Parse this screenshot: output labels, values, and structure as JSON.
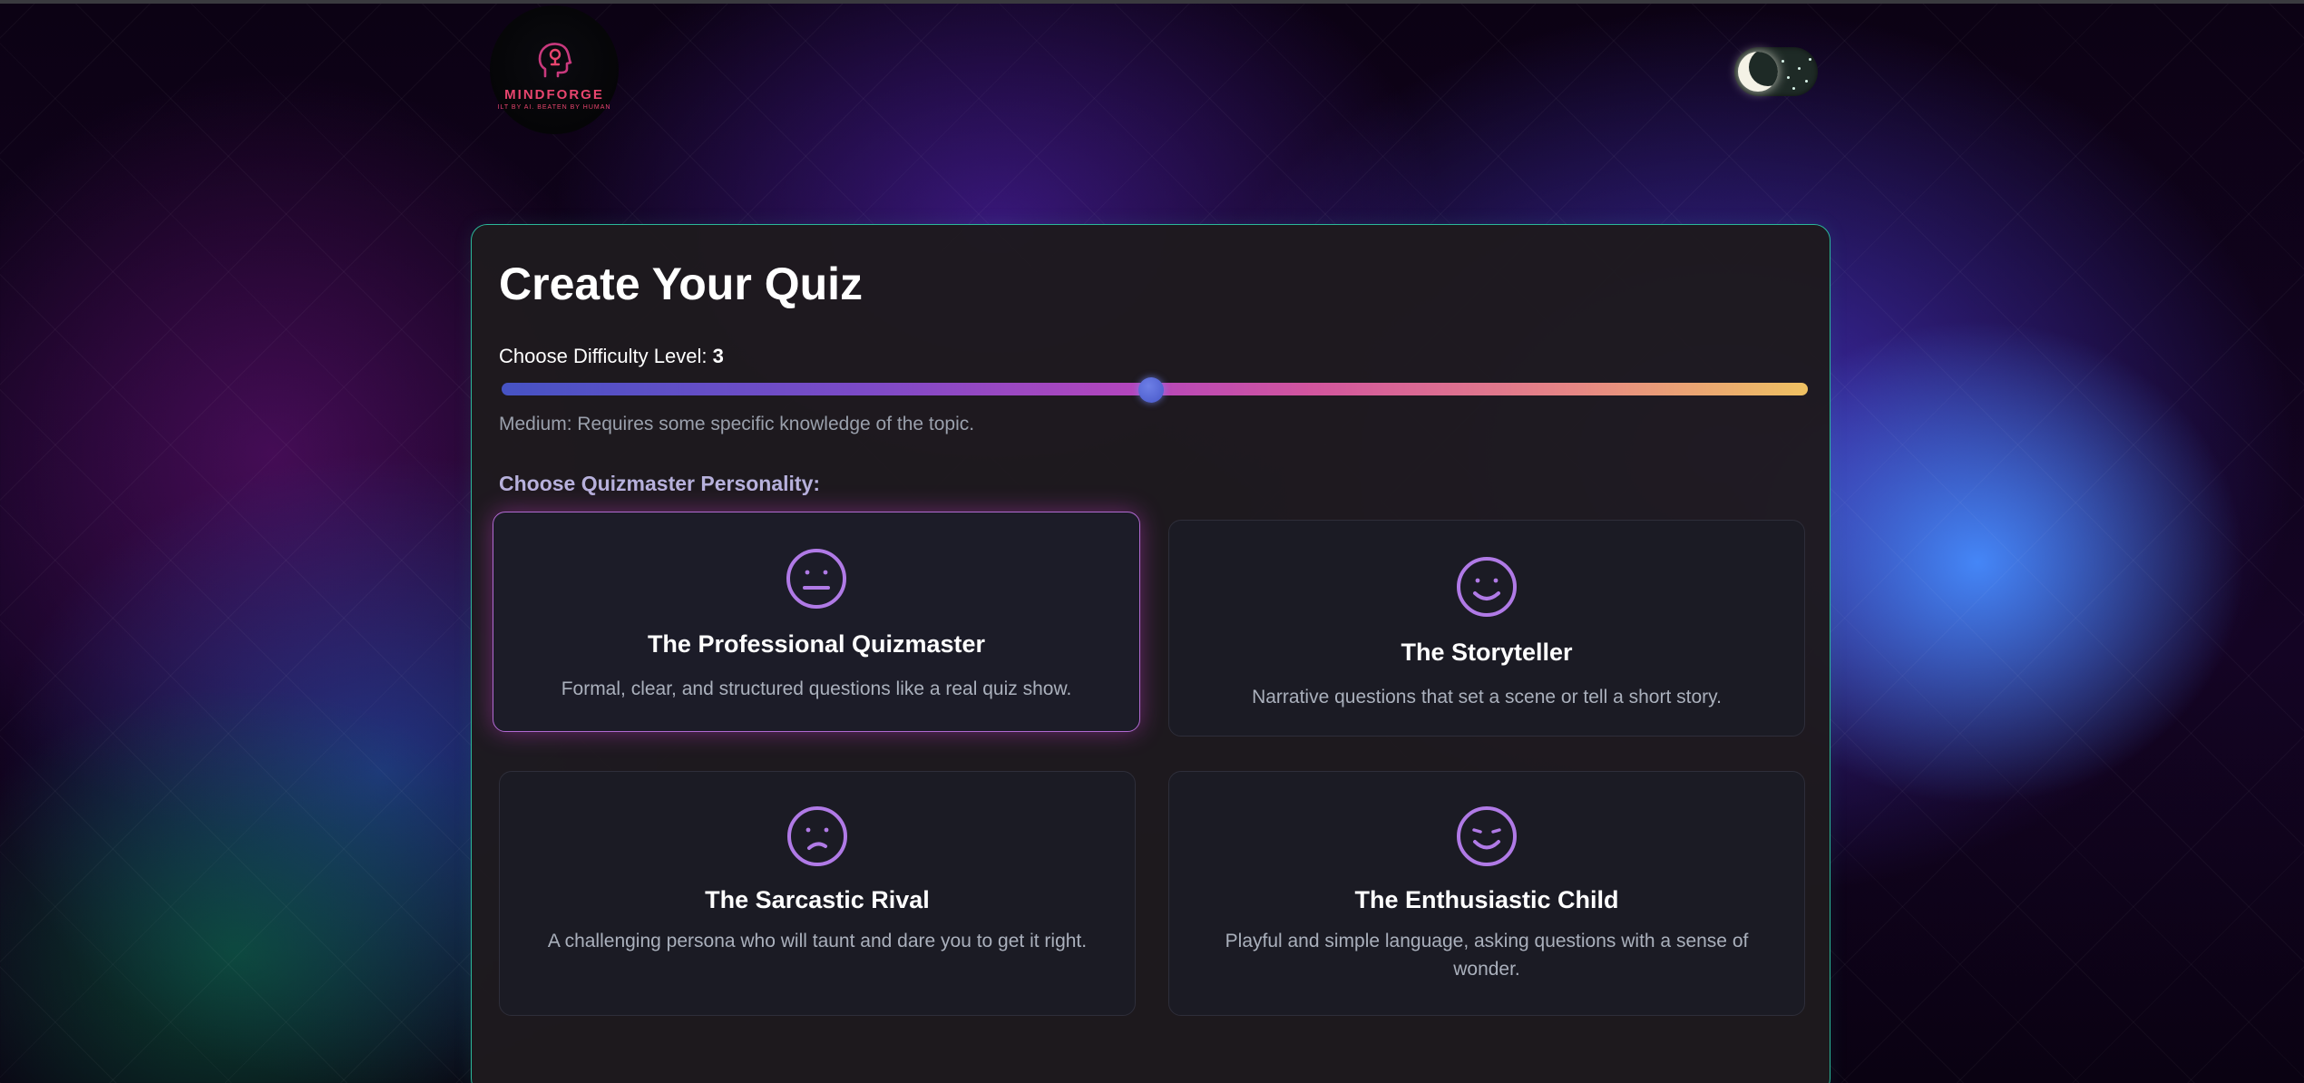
{
  "brand": {
    "name": "MINDFORGE",
    "tagline": "ILT BY AI. BEATEN BY HUMAN"
  },
  "theme_toggle": {
    "mode": "dark",
    "icon": "moon-icon"
  },
  "quiz": {
    "title": "Create Your Quiz",
    "difficulty": {
      "label": "Choose Difficulty Level: ",
      "value": "3",
      "level": 3,
      "min": 1,
      "max": 5,
      "description": "Medium: Requires some specific knowledge of the topic."
    },
    "personality_label": "Choose Quizmaster Personality:",
    "personalities": [
      {
        "title": "The Professional Quizmaster",
        "description": "Formal, clear, and structured questions like a real quiz show.",
        "icon": "neutral-face-icon",
        "selected": true
      },
      {
        "title": "The Storyteller",
        "description": "Narrative questions that set a scene or tell a short story.",
        "icon": "smile-face-icon",
        "selected": false
      },
      {
        "title": "The Sarcastic Rival",
        "description": "A challenging persona who will taunt and dare you to get it right.",
        "icon": "smirk-face-icon",
        "selected": false
      },
      {
        "title": "The Enthusiastic Child",
        "description": "Playful and simple language, asking questions with a sense of wonder.",
        "icon": "happy-face-icon",
        "selected": false
      }
    ]
  },
  "colors": {
    "panel_border": "#2bb89a",
    "accent_purple": "#b07ae6",
    "brand_pink": "#e8456e"
  }
}
